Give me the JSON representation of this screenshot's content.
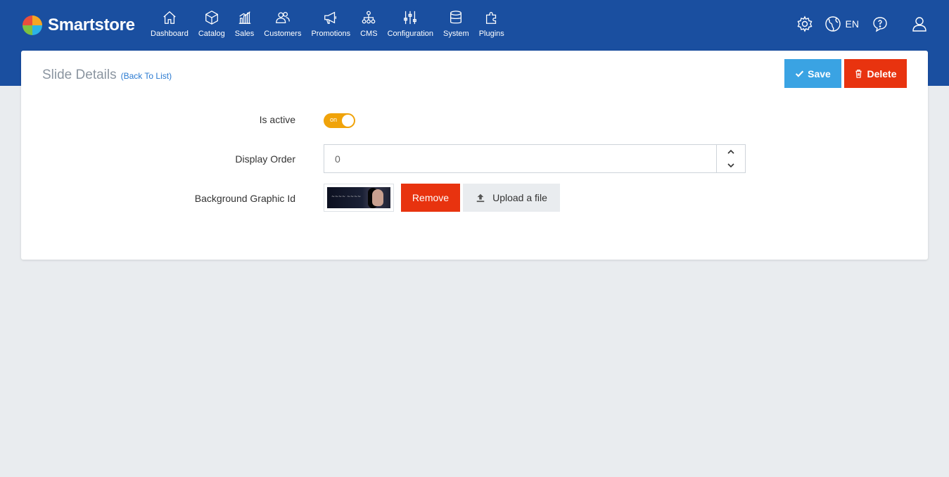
{
  "brand": {
    "name": "Smartstore"
  },
  "nav": [
    {
      "label": "Dashboard",
      "icon": "home-icon"
    },
    {
      "label": "Catalog",
      "icon": "box-icon"
    },
    {
      "label": "Sales",
      "icon": "bar-chart-icon"
    },
    {
      "label": "Customers",
      "icon": "users-icon"
    },
    {
      "label": "Promotions",
      "icon": "megaphone-icon"
    },
    {
      "label": "CMS",
      "icon": "sitemap-icon"
    },
    {
      "label": "Configuration",
      "icon": "sliders-icon"
    },
    {
      "label": "System",
      "icon": "database-icon"
    },
    {
      "label": "Plugins",
      "icon": "puzzle-icon"
    }
  ],
  "header": {
    "language": "EN"
  },
  "page": {
    "title": "Slide Details",
    "back_link": "(Back To List)",
    "save_label": "Save",
    "delete_label": "Delete"
  },
  "form": {
    "is_active": {
      "label": "Is active",
      "toggle_text": "on",
      "value": true
    },
    "display_order": {
      "label": "Display Order",
      "value": "0"
    },
    "background_graphic": {
      "label": "Background Graphic Id",
      "remove_label": "Remove",
      "upload_label": "Upload a file"
    }
  },
  "colors": {
    "topbar": "#1a4fa0",
    "save": "#3aa3e3",
    "delete": "#e8330f",
    "toggle_on": "#f0a30a",
    "background": "#e9ecef"
  }
}
